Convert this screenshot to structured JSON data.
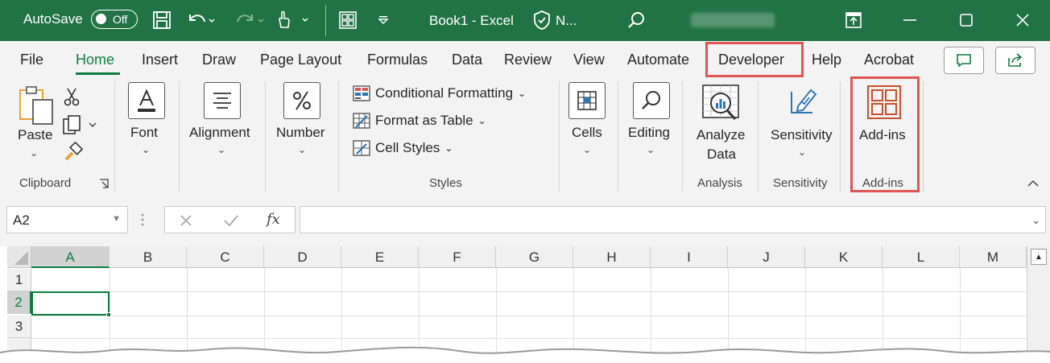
{
  "titlebar": {
    "autosave_label": "AutoSave",
    "autosave_state": "Off",
    "doc_title": "Book1  -  Excel",
    "sensitivity_short": "N...",
    "bg_color": "#217346"
  },
  "tabs": [
    {
      "label": "File"
    },
    {
      "label": "Home"
    },
    {
      "label": "Insert"
    },
    {
      "label": "Draw"
    },
    {
      "label": "Page Layout"
    },
    {
      "label": "Formulas"
    },
    {
      "label": "Data"
    },
    {
      "label": "Review"
    },
    {
      "label": "View"
    },
    {
      "label": "Automate"
    },
    {
      "label": "Developer"
    },
    {
      "label": "Help"
    },
    {
      "label": "Acrobat"
    }
  ],
  "active_tab": "Home",
  "highlight_color": "#e15552",
  "accent_color": "#107c41",
  "ribbon": {
    "clipboard": {
      "paste_label": "Paste",
      "group_label": "Clipboard"
    },
    "font": {
      "label": "Font"
    },
    "alignment": {
      "label": "Alignment"
    },
    "number": {
      "label": "Number"
    },
    "styles": {
      "items": [
        "Conditional Formatting",
        "Format as Table",
        "Cell Styles"
      ],
      "group_label": "Styles"
    },
    "cells": {
      "label": "Cells"
    },
    "editing": {
      "label": "Editing"
    },
    "analysis": {
      "button_line1": "Analyze",
      "button_line2": "Data",
      "group_label": "Analysis"
    },
    "sensitivity": {
      "button_label": "Sensitivity",
      "group_label": "Sensitivity"
    },
    "addins": {
      "button_label": "Add-ins",
      "group_label": "Add-ins"
    }
  },
  "formula_bar": {
    "name_box": "A2",
    "fx": "fx",
    "value": ""
  },
  "grid": {
    "columns": [
      "A",
      "B",
      "C",
      "D",
      "E",
      "F",
      "G",
      "H",
      "I",
      "J",
      "K",
      "L",
      "M"
    ],
    "rows": [
      "1",
      "2",
      "3"
    ],
    "selected_column": "A",
    "selected_row": "2"
  }
}
